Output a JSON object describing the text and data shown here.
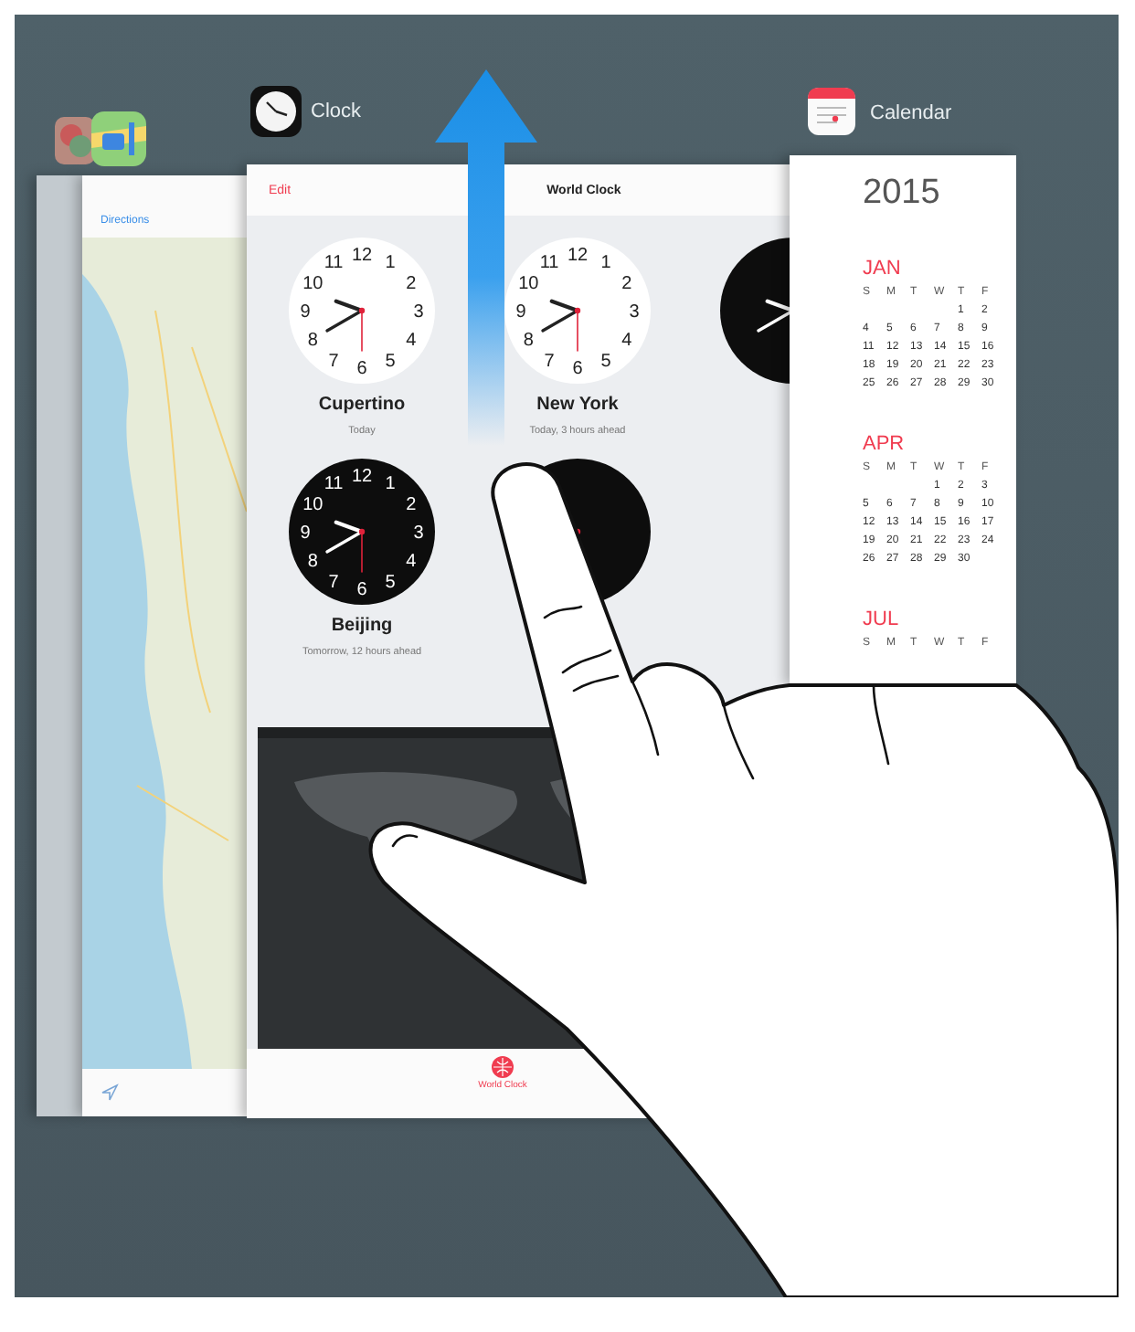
{
  "app_switcher": {
    "apps": [
      {
        "kind": "photos"
      },
      {
        "kind": "maps",
        "header_button": "Directions"
      },
      {
        "kind": "clock",
        "label": "Clock",
        "edit_button": "Edit",
        "title": "World Clock",
        "clocks": [
          {
            "city": "Cupertino",
            "note": "Today",
            "kind": "light",
            "numerals": [
              "11",
              "12",
              "1",
              "10",
              "2",
              "9",
              "3",
              "8",
              "4",
              "7",
              "6",
              "5"
            ]
          },
          {
            "city": "New York",
            "note": "Today, 3 hours ahead",
            "kind": "light",
            "numerals": [
              "11",
              "12",
              "1",
              "10",
              "2",
              "9",
              "3",
              "8",
              "4",
              "7",
              "6",
              "5"
            ]
          },
          {
            "kind": "dark"
          },
          {
            "city": "Beijing",
            "note": "Tomorrow, 12 hours ahead",
            "kind": "dark",
            "numerals": [
              "11",
              "12",
              "1",
              "10",
              "2",
              "9",
              "3",
              "8",
              "4",
              "7",
              "6",
              "5"
            ]
          },
          {
            "kind": "dark"
          }
        ],
        "tab_label": "World Clock"
      },
      {
        "kind": "calendar",
        "label": "Calendar",
        "year": "2015",
        "months": [
          {
            "name": "JAN",
            "weekdays": [
              "S",
              "M",
              "T",
              "W",
              "T",
              "F"
            ],
            "weeks": [
              [
                "1",
                "2"
              ],
              [
                "4",
                "5",
                "6",
                "7",
                "8",
                "9"
              ],
              [
                "11",
                "12",
                "13",
                "14",
                "15",
                "16"
              ],
              [
                "18",
                "19",
                "20",
                "21",
                "22",
                "23"
              ],
              [
                "25",
                "26",
                "27",
                "28",
                "29",
                "30"
              ]
            ]
          },
          {
            "name": "APR",
            "weekdays": [
              "S",
              "M",
              "T",
              "W",
              "T",
              "F"
            ],
            "weeks": [
              [
                "1",
                "2",
                "3"
              ],
              [
                "5",
                "6",
                "7",
                "8",
                "9",
                "10"
              ],
              [
                "12",
                "13",
                "14",
                "15",
                "16",
                "17"
              ],
              [
                "19",
                "20",
                "21",
                "22",
                "23",
                "24"
              ],
              [
                "26",
                "27",
                "28",
                "29",
                "30"
              ]
            ]
          },
          {
            "name": "JUL",
            "weekdays": [
              "S",
              "M",
              "T",
              "W",
              "T",
              "F"
            ]
          }
        ]
      }
    ]
  }
}
